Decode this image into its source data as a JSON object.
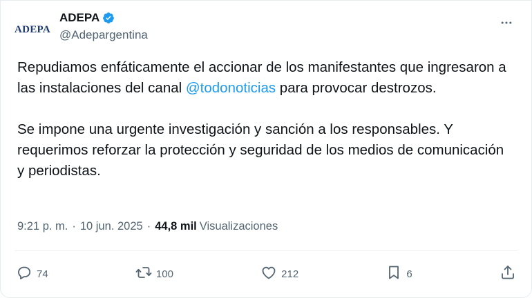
{
  "author": {
    "logo_text": "ADEPA",
    "display_name": "ADEPA",
    "handle": "@Adepargentina",
    "verified_color": "#1d9bf0"
  },
  "tweet": {
    "p1_before": "Repudiamos enfáticamente el accionar de los manifestantes que ingresaron a las instalaciones del canal ",
    "mention": "@todonoticias",
    "p1_after": " para provocar destrozos.",
    "p2": "Se impone una urgente investigación y sanción a los responsables. Y requerimos reforzar la protección y seguridad de los medios de comunicación y periodistas."
  },
  "meta": {
    "time": "9:21 p. m.",
    "separator": "·",
    "date": "10 jun. 2025",
    "views_count": "44,8 mil",
    "views_label": "Visualizaciones"
  },
  "actions": {
    "replies": "74",
    "reposts": "100",
    "likes": "212",
    "bookmarks": "6"
  },
  "icons": [
    "verified-badge-icon",
    "more-icon",
    "reply-icon",
    "repost-icon",
    "like-icon",
    "bookmark-icon",
    "share-icon"
  ]
}
